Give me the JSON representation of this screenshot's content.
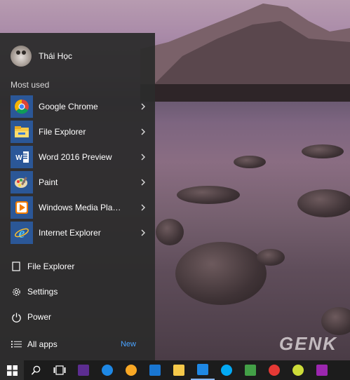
{
  "user": {
    "name": "Thái Học"
  },
  "most_used": {
    "title": "Most used",
    "apps": [
      {
        "label": "Google Chrome",
        "icon": "chrome-icon"
      },
      {
        "label": "File Explorer",
        "icon": "file-explorer-icon"
      },
      {
        "label": "Word 2016 Preview",
        "icon": "word-icon"
      },
      {
        "label": "Paint",
        "icon": "paint-icon"
      },
      {
        "label": "Windows Media Player",
        "icon": "media-player-icon"
      },
      {
        "label": "Internet Explorer",
        "icon": "internet-explorer-icon"
      }
    ]
  },
  "bottom": {
    "file_explorer": "File Explorer",
    "settings": "Settings",
    "power": "Power",
    "all_apps": "All apps",
    "new_badge": "New"
  },
  "watermark": "GENK",
  "taskbar": {
    "icons": [
      "windows-start-icon",
      "search-icon",
      "task-view-icon",
      "settings-app-icon",
      "edge-icon",
      "media-icon",
      "mail-icon",
      "file-explorer-icon",
      "store-icon",
      "skype-icon",
      "gotv-icon",
      "photos-icon",
      "paint-icon",
      "more-icon"
    ]
  },
  "colors": {
    "accent": "#4aa3ff",
    "menu_bg": "#2c2c2c",
    "taskbar_bg": "#1c1c1c"
  }
}
